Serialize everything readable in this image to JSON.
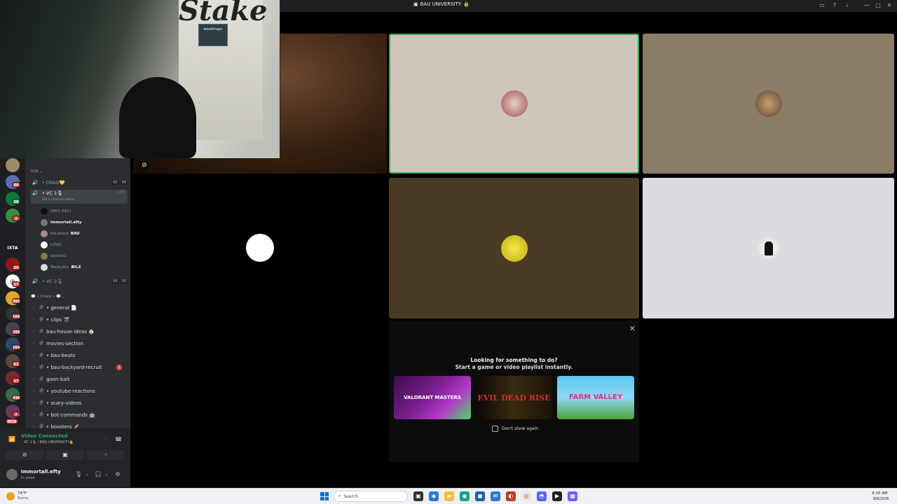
{
  "window": {
    "title": "BAU UNIVERSITY",
    "title_emoji": "🔒"
  },
  "webcam": {
    "logo_text": "Stake",
    "sign_text": "weedmaps"
  },
  "server": {
    "category_ssb": "SSB",
    "voice_channels": [
      {
        "name": "DRAG",
        "emoji": "💛",
        "count_a": "00",
        "count_b": "99"
      },
      {
        "name": "VC 1",
        "emoji": "🎙",
        "status": "Set a channel status",
        "time": "1:56",
        "active": true
      },
      {
        "name": "VC 2",
        "emoji": "🎙",
        "count_a": "00",
        "count_b": "50"
      }
    ],
    "members": [
      {
        "name": "2001 0911"
      },
      {
        "name": "Immortall.efty",
        "bright": true
      },
      {
        "name": "ItzLeland",
        "tag": "BAU"
      },
      {
        "name": "LZWZ"
      },
      {
        "name": "slyshot1"
      },
      {
        "name": "TeeJay6ix",
        "tag": "BILZ"
      }
    ],
    "chats_category": "Chats",
    "text_channels": [
      {
        "name": "general",
        "emoji": "📄",
        "dot": true
      },
      {
        "name": "clips",
        "emoji": "🎬",
        "dot": true
      },
      {
        "name": "bau-house-ideas",
        "emoji": "🏠",
        "dot": false
      },
      {
        "name": "movies-section",
        "dot": false
      },
      {
        "name": "bau-beats",
        "dot": true
      },
      {
        "name": "bau-backyard-recruit",
        "dot": true,
        "badge": "2"
      },
      {
        "name": "goon-bait",
        "dot": false
      },
      {
        "name": "youtube-reactions",
        "dot": true
      },
      {
        "name": "scary-videos",
        "dot": true
      },
      {
        "name": "bot-commands",
        "emoji": "🤖",
        "dot": true
      },
      {
        "name": "boosters",
        "emoji": "🚀",
        "dot": true
      }
    ]
  },
  "guild_badges": [
    "80",
    "36",
    "3",
    "20",
    "27",
    "885",
    "166",
    "286",
    "164",
    "63",
    "27",
    "430",
    "7",
    "NEW"
  ],
  "guild_label": "IXTA",
  "voice_panel": {
    "status": "Video Connected",
    "sub": "VC 1🎙 / BAU UNIVERSITY🔒"
  },
  "user_panel": {
    "name": "Immortall.efty",
    "sub": "In voice"
  },
  "activity": {
    "heading": "Looking for something to do?",
    "subheading": "Start a game or video playlist instantly.",
    "games": [
      "VALORANT MASTERS",
      "EVIL DEAD RISE",
      "FARM VALLEY"
    ],
    "dont_show": "Don't show again"
  },
  "taskbar": {
    "weather_temp": "74°F",
    "weather_desc": "Sunny",
    "search_placeholder": "Search",
    "time": "9:16 AM",
    "date": "8/6/2026"
  },
  "colors": {
    "connected": "#23a55a",
    "speaking_border": "#3ba55d",
    "badge": "#f23f43"
  }
}
